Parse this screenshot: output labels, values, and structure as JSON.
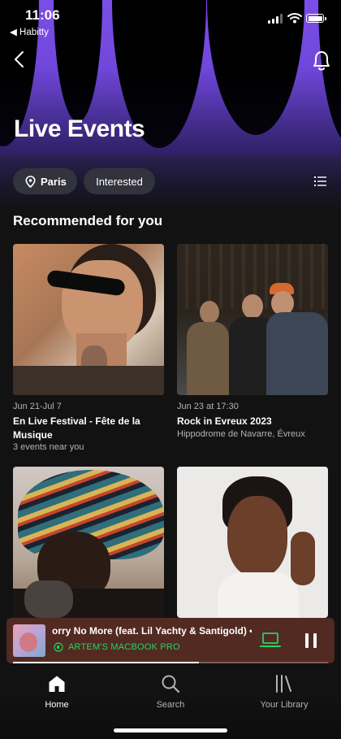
{
  "status_bar": {
    "time": "11:06",
    "back_app": "◀ Habitty",
    "icons": [
      "signal-icon",
      "wifi-icon",
      "battery-icon"
    ]
  },
  "header": {
    "title": "Live Events",
    "back_icon": "back-chevron-icon",
    "bell_icon": "bell-icon"
  },
  "filters": {
    "location": "Paris",
    "location_icon": "location-pin-icon",
    "interested": "Interested",
    "list_icon": "list-view-icon"
  },
  "section": {
    "title": "Recommended for you"
  },
  "events": [
    {
      "date": "Jun 21-Jul 7",
      "name": "En Live Festival - Fête de la Musique",
      "sub": "3 events near you"
    },
    {
      "date": "Jun 23 at 17:30",
      "name": "Rock in Evreux 2023",
      "sub": "Hippodrome de Navarre, Évreux"
    },
    {
      "date": "",
      "name": "",
      "sub": ""
    },
    {
      "date": "",
      "name": "",
      "sub": ""
    }
  ],
  "player": {
    "track": "orry No More (feat. Lil Yachty & Santigold) •",
    "device": "ARTEM'S MACBOOK PRO",
    "progress": 0.59,
    "device_icon": "laptop-icon",
    "pause_icon": "pause-icon"
  },
  "tabs": [
    {
      "label": "Home",
      "icon": "home-icon",
      "active": true
    },
    {
      "label": "Search",
      "icon": "search-icon",
      "active": false
    },
    {
      "label": "Your Library",
      "icon": "library-icon",
      "active": false
    }
  ],
  "colors": {
    "accent": "#1ed760",
    "hero": "#7a4ee8",
    "background": "#121212",
    "player": "#522a22"
  }
}
